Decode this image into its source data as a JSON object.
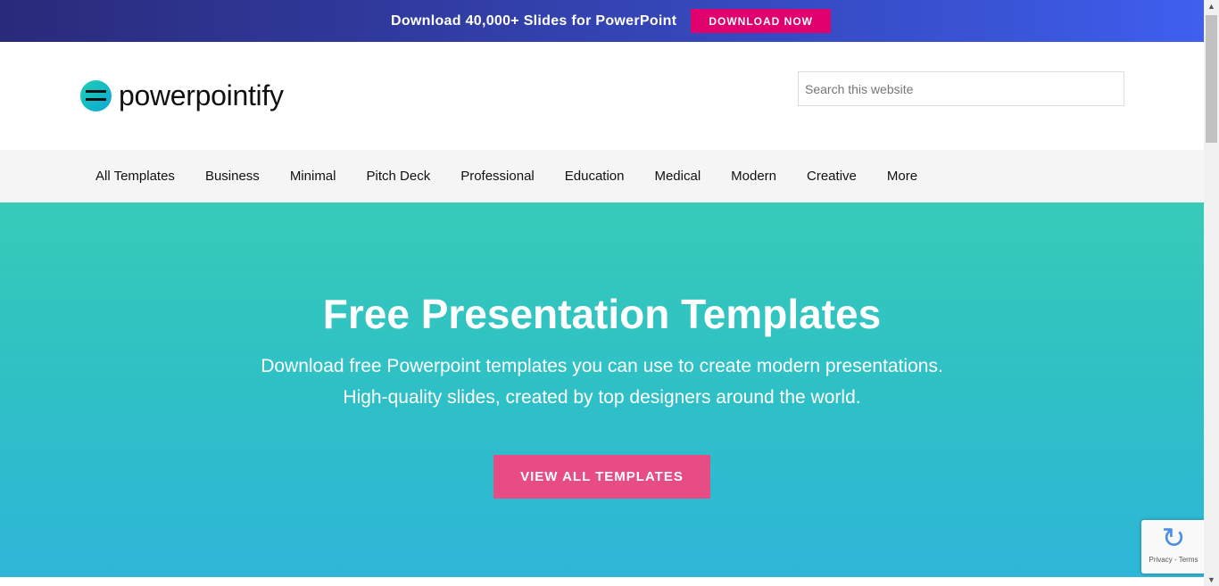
{
  "promo": {
    "text": "Download 40,000+ Slides for PowerPoint",
    "button": "DOWNLOAD NOW"
  },
  "header": {
    "logo_text": "powerpointify",
    "search_placeholder": "Search this website"
  },
  "nav": {
    "items": [
      "All Templates",
      "Business",
      "Minimal",
      "Pitch Deck",
      "Professional",
      "Education",
      "Medical",
      "Modern",
      "Creative",
      "More"
    ]
  },
  "hero": {
    "title": "Free Presentation Templates",
    "subtitle": "Download free Powerpoint templates you can use to create modern presentations. High-quality slides, created by top designers around the world.",
    "cta": "VIEW ALL TEMPLATES"
  },
  "recaptcha": {
    "links": "Privacy - Terms"
  },
  "colors": {
    "accent": "#e0006e",
    "cta": "#e74c85",
    "hero": "#2fc0c6"
  }
}
